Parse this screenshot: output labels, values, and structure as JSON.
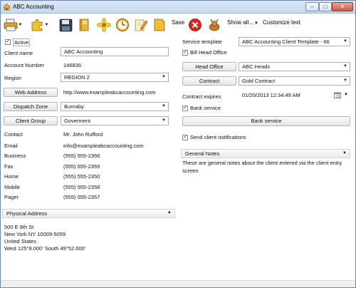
{
  "window": {
    "title": "ABC Accounting",
    "minimize_glyph": "–",
    "maximize_glyph": "□",
    "close_glyph": "✕"
  },
  "toolbar": {
    "icons": [
      "printer-icon",
      "puzzle-icon",
      "save-disk-icon",
      "book-icon",
      "flower-icon",
      "clock-icon",
      "edit-icon",
      "note-icon",
      "stop-icon",
      "deer-icon"
    ],
    "save_label": "Save",
    "show_all_label": "Show all...",
    "customize_label": "Customize text",
    "dropdown_arrow": "▼"
  },
  "left": {
    "active_check": "✓",
    "active_label": "Active",
    "client_name_label": "Client name",
    "client_name_value": "ABC Accounting",
    "account_number_label": "Account Number",
    "account_number_value": "146836",
    "region_label": "Region",
    "region_value": "REGION 2",
    "web_address_label": "Web Address",
    "web_address_value": "http://www.exampleabcaccounting.com",
    "dispatch_zone_label": "Dispatch Zone",
    "dispatch_zone_value": "Burnaby",
    "client_group_label": "Client Group",
    "client_group_value": "Goverment",
    "contact_label": "Contact",
    "contact_value": "Mr. John Rufford",
    "email_label": "Email",
    "email_value": "info@exampleabcaccounting.com",
    "business_label": "Business",
    "business_value": "(555) 555-2366",
    "fax_label": "Fax",
    "fax_value": "(555) 555-2359",
    "home_label": "Home",
    "home_value": "(555) 555-2350",
    "mobile_label": "Mobile",
    "mobile_value": "(555) 555-2358",
    "pager_label": "Pager",
    "pager_value": "(555) 555-2357",
    "physical_address_label": "Physical Address",
    "address_lines": [
      "500 E 9th St",
      "New York NY  10009-5059",
      "United States",
      "West 125°8.000'   South 49°52.000'"
    ]
  },
  "right": {
    "service_template_label": "Service template",
    "service_template_value": "ABC Accounting Client Template - 66",
    "bill_head_office_check": "✓",
    "bill_head_office_label": "Bill Head Office",
    "head_office_label": "Head Office",
    "head_office_value": "ABC Heads",
    "contract_label": "Contract",
    "contract_value": "Gold Contract",
    "contract_expires_label": "Contract expires",
    "contract_expires_value": "01/20/2013 12:34:49 AM",
    "bank_service_check": "✓",
    "bank_service_label": "Bank service",
    "bank_service_button": "Bank service",
    "send_notifications_check": "✓",
    "send_notifications_label": "Send client notifications",
    "general_notes_label": "General Notes",
    "general_notes_text": "These are general notes about the client entered via the client entry screen"
  },
  "colors": {
    "titlebar": "#c6d9ef",
    "close_button": "#c9584a",
    "border": "#adadad"
  }
}
